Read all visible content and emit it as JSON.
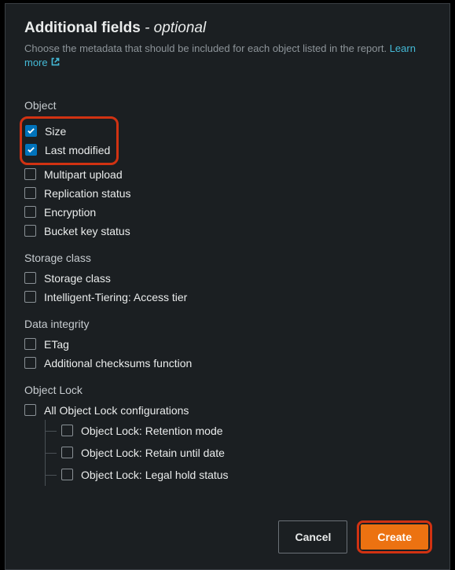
{
  "header": {
    "title": "Additional fields",
    "title_suffix": "- optional",
    "description": "Choose the metadata that should be included for each object listed in the report. ",
    "learn_more": "Learn more"
  },
  "groups": {
    "object": {
      "label": "Object",
      "size": "Size",
      "last_modified": "Last modified",
      "multipart": "Multipart upload",
      "replication": "Replication status",
      "encryption": "Encryption",
      "bucket_key": "Bucket key status"
    },
    "storage_class": {
      "label": "Storage class",
      "storage_class": "Storage class",
      "intelligent_tiering": "Intelligent-Tiering: Access tier"
    },
    "data_integrity": {
      "label": "Data integrity",
      "etag": "ETag",
      "checksums": "Additional checksums function"
    },
    "object_lock": {
      "label": "Object Lock",
      "all": "All Object Lock configurations",
      "retention_mode": "Object Lock: Retention mode",
      "retain_until": "Object Lock: Retain until date",
      "legal_hold": "Object Lock: Legal hold status"
    }
  },
  "footer": {
    "cancel": "Cancel",
    "create": "Create"
  }
}
